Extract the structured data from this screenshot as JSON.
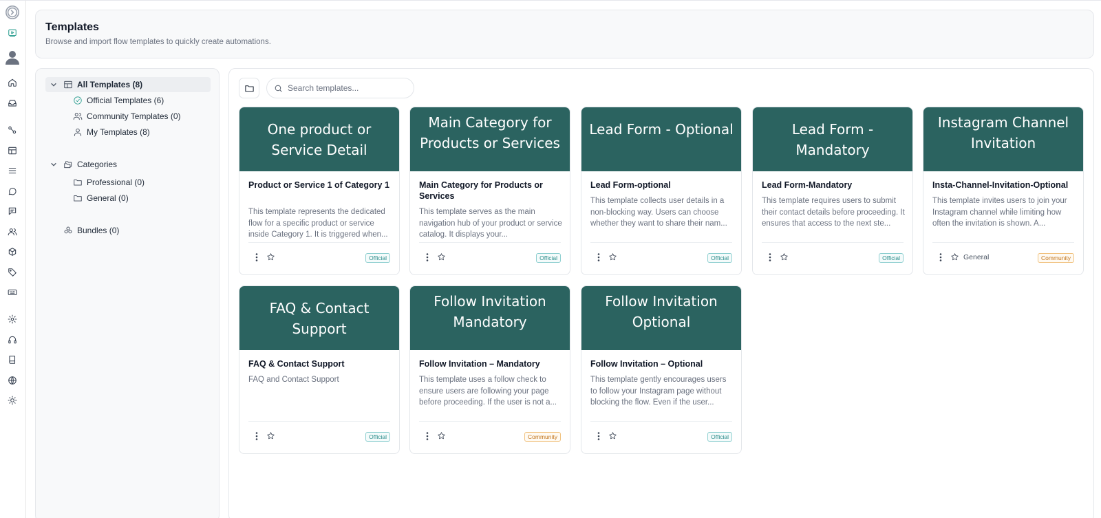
{
  "header": {
    "title": "Templates",
    "subtitle": "Browse and import flow templates to quickly create automations."
  },
  "rail": {
    "icons": [
      "collapse-icon",
      "flow-player-icon",
      "avatar",
      "home-icon",
      "inbox-icon",
      "integrations-icon",
      "layout-icon",
      "list-icon",
      "chat-icon",
      "messages-icon",
      "users-icon",
      "box-icon",
      "tag-icon",
      "keyboard-icon",
      "settings-icon",
      "headphones-icon",
      "book-icon",
      "globe-icon",
      "sun-icon"
    ]
  },
  "sidebar": {
    "all_templates": "All Templates (8)",
    "official": "Official Templates (6)",
    "community": "Community Templates (0)",
    "mine": "My Templates (8)",
    "categories": "Categories",
    "professional": "Professional (0)",
    "general": "General (0)",
    "bundles": "Bundles (0)"
  },
  "search": {
    "placeholder": "Search templates..."
  },
  "cards": [
    {
      "banner": "One product or Service Detail",
      "title": "Product or Service 1 of Category 1",
      "desc": "This template represents the dedicated flow for a specific product or service inside Category 1. It is triggered when...",
      "badge": "Official",
      "category": ""
    },
    {
      "banner": "Main Category for Products or Services",
      "title": "Main Category for Products or Services",
      "desc": "This template serves as the main navigation hub of your product or service catalog. It displays your...",
      "badge": "Official",
      "category": ""
    },
    {
      "banner": "Lead Form - Optional",
      "title": "Lead Form-optional",
      "desc": "This template collects user details in a non-blocking way. Users can choose whether they want to share their nam...",
      "badge": "Official",
      "category": ""
    },
    {
      "banner": "Lead Form - Mandatory",
      "title": "Lead Form-Mandatory",
      "desc": "This template requires users to submit their contact details before proceeding. It ensures that access to the next ste...",
      "badge": "Official",
      "category": ""
    },
    {
      "banner": "Instagram Channel Invitation",
      "title": "Insta-Channel-Invitation-Optional",
      "desc": "This template invites users to join your Instagram channel while limiting how often the invitation is shown. A...",
      "badge": "Community",
      "category": "General"
    },
    {
      "banner": "FAQ & Contact Support",
      "title": "FAQ & Contact Support",
      "desc": "FAQ and Contact Support",
      "badge": "Official",
      "category": ""
    },
    {
      "banner": "Follow Invitation Mandatory",
      "title": "Follow Invitation – Mandatory",
      "desc": "This template uses a follow check to ensure users are following your page before proceeding. If the user is not a...",
      "badge": "Community",
      "category": ""
    },
    {
      "banner": "Follow Invitation Optional",
      "title": "Follow Invitation – Optional",
      "desc": "This template gently encourages users to follow your Instagram page without blocking the flow. Even if the user...",
      "badge": "Official",
      "category": ""
    }
  ]
}
